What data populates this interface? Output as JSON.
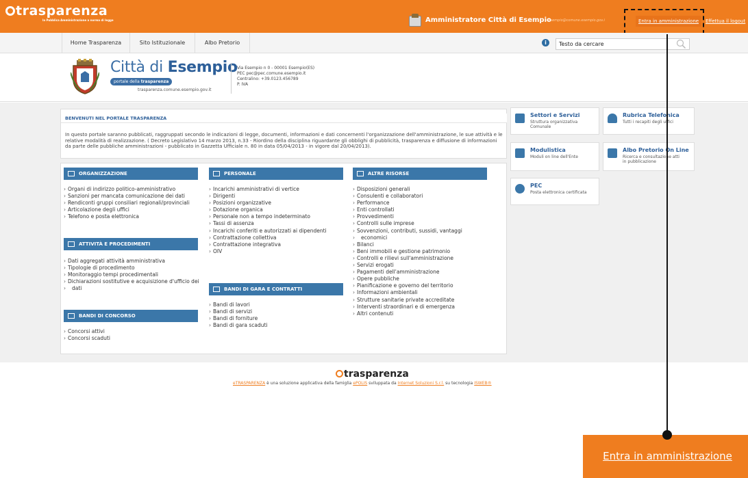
{
  "topbar": {
    "logo": "trasparenza",
    "logo_sub": "la Pubblica Amministrazione a norma di legge",
    "admin_name": "Amministratore Città di Esempio",
    "admin_email": "- esempio@comune.esempio.gov.i",
    "admin_button": "Entra in amministrazione",
    "logout_button": "Effettua il logout",
    "accent_color": "#ef7d1f"
  },
  "nav": {
    "items": [
      "Home Trasparenza",
      "Sito Istituzionale",
      "Albo Pretorio"
    ],
    "search_value": "Testo da cercare"
  },
  "header": {
    "title_a": "Città di",
    "title_b": "Esempio",
    "pill_a": "portale della",
    "pill_b": "trasparenza",
    "url": "trasparenza.comune.esempio.gov.it",
    "address_lines": [
      "Via Esempio n 0 - 00001 Esempio(ES)",
      "PEC pec@pec.comune.esempio.it",
      "Centralino: +39.0123.456789",
      "P. IVA"
    ]
  },
  "welcome": {
    "heading": "BENVENUTI NEL PORTALE TRASPARENZA",
    "text": "In questo portale saranno pubblicati, raggruppati secondo le indicazioni di legge, documenti, informazioni e dati concernenti l'organizzazione dell'amministrazione, le sue attività e le relative modalità di realizzazione. ( Decreto Legislativo 14 marzo 2013, n.33 - Riordino della disciplina riguardante gli obblighi di pubblicità, trasparenza e diffusione di informazioni da parte delle pubbliche amministrazioni - pubblicato in Gazzetta Ufficiale n. 80 in data 05/04/2013 - in vigore dal 20/04/2013)."
  },
  "sections": {
    "organizzazione": {
      "title": "ORGANIZZAZIONE",
      "items": [
        "Organi di indirizzo politico-amministrativo",
        "Sanzioni per mancata comunicazione dei dati",
        "Rendiconti gruppi consiliari regionali/provinciali",
        "Articolazione degli uffici",
        "Telefono e posta elettronica"
      ]
    },
    "attivita": {
      "title": "ATTIVITÀ E PROCEDIMENTI",
      "items": [
        "Dati aggregati attività amministrativa",
        "Tipologie di procedimento",
        "Monitoraggio tempi procedimentali",
        "Dichiarazioni sostitutive e acquisizione d'ufficio dei",
        "dati"
      ]
    },
    "concorso": {
      "title": "BANDI DI CONCORSO",
      "items": [
        "Concorsi attivi",
        "Concorsi scaduti"
      ]
    },
    "personale": {
      "title": "PERSONALE",
      "items": [
        "Incarichi amministrativi di vertice",
        "Dirigenti",
        "Posizioni organizzative",
        "Dotazione organica",
        "Personale non a tempo indeterminato",
        "Tassi di assenza",
        "Incarichi conferiti e autorizzati ai dipendenti",
        "Contrattazione collettiva",
        "Contrattazione integrativa",
        "OIV"
      ]
    },
    "gara": {
      "title": "BANDI DI GARA E CONTRATTI",
      "items": [
        "Bandi di lavori",
        "Bandi di servizi",
        "Bandi di forniture",
        "Bandi di gara scaduti"
      ]
    },
    "altre": {
      "title": "ALTRE RISORSE",
      "items": [
        "Disposizioni generali",
        "Consulenti e collaboratori",
        "Performance",
        "Enti controllati",
        "Provvedimenti",
        "Controlli sulle imprese",
        "Sovvenzioni, contributi, sussidi, vantaggi",
        "economici",
        "Bilanci",
        "Beni immobili e gestione patrimonio",
        "Controlli e rilievi sull'amministrazione",
        "Servizi erogati",
        "Pagamenti dell'amministrazione",
        "Opere pubbliche",
        "Pianificazione e governo del territorio",
        "Informazioni ambientali",
        "Strutture sanitarie private accreditate",
        "Interventi straordinari e di emergenza",
        "Altri contenuti"
      ]
    }
  },
  "widgets": {
    "settori": {
      "title": "Settori e Servizi",
      "sub": "Struttura organizzativa Comunale"
    },
    "rubrica": {
      "title": "Rubrica Telefonica",
      "sub": "Tutti i recapiti degli uffici"
    },
    "modulistica": {
      "title": "Modulistica",
      "sub": "Moduli on line dell'Ente"
    },
    "albo": {
      "title": "Albo Pretorio On Line",
      "sub": "Ricerca e consultazione atti in pubblicazione"
    },
    "pec": {
      "title": "PEC",
      "sub": "Posta elettronica certificata"
    }
  },
  "footer": {
    "logo": "trasparenza",
    "t1": "eTRASPARENZA",
    "t2": " è una soluzione applicativa della famiglia ",
    "t3": "ePOLIS",
    "t4": " sviluppata da ",
    "t5": "Internet Soluzioni S.r.l.",
    "t6": " su tecnologia ",
    "t7": "ISWEB®"
  },
  "callout": {
    "label": "Entra in amministrazione"
  }
}
